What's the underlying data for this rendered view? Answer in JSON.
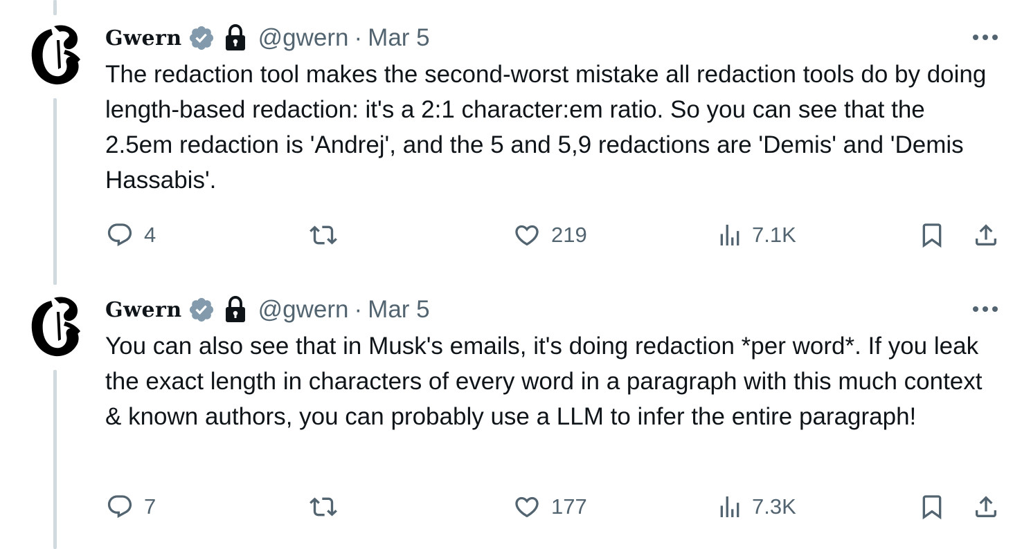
{
  "colors": {
    "text": "#0f1419",
    "secondary": "#536471",
    "thread_line": "#cfd9de",
    "verified_badge": "#829aab"
  },
  "tweets": [
    {
      "author_name": "Gwern",
      "handle": "@gwern",
      "separator": "·",
      "date": "Mar 5",
      "text": "The redaction tool makes the second-worst mistake all redaction tools do by doing length-based redaction: it's a 2:1 character:em ratio. So you can see that the 2.5em redaction is 'Andrej', and the 5 and 5,9 redactions are 'Demis' and 'Demis Hassabis'.",
      "replies": "4",
      "likes": "219",
      "views": "7.1K"
    },
    {
      "author_name": "Gwern",
      "handle": "@gwern",
      "separator": "·",
      "date": "Mar 5",
      "text": "You can also see that in Musk's emails, it's doing redaction *per word*. If you leak the exact length in characters of every word in a paragraph with this much context & known authors, you can probably use a LLM to infer the entire paragraph!",
      "replies": "7",
      "likes": "177",
      "views": "7.3K"
    }
  ],
  "icons": {
    "avatar": "gwern-blackletter-g-logo",
    "verified": "verified-badge-icon",
    "lock": "lock-icon",
    "more": "more-dots-icon",
    "reply": "reply-icon",
    "retweet": "retweet-icon",
    "like": "heart-icon",
    "views": "views-chart-icon",
    "bookmark": "bookmark-icon",
    "share": "share-icon"
  }
}
